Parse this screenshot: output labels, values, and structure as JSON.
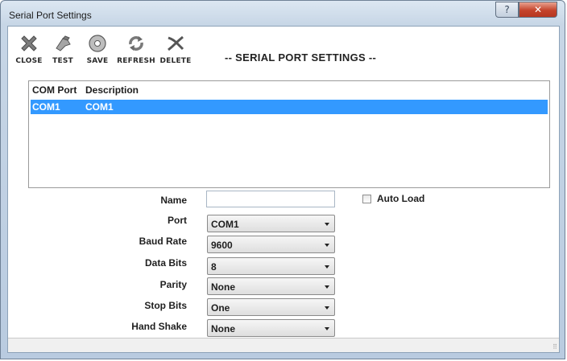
{
  "window": {
    "title": "Serial Port Settings",
    "help_label": "?",
    "close_label": "✕"
  },
  "toolbar": {
    "buttons": [
      {
        "label": "CLOSE",
        "icon": "close-x-icon"
      },
      {
        "label": "TEST",
        "icon": "test-probe-icon"
      },
      {
        "label": "SAVE",
        "icon": "disk-icon"
      },
      {
        "label": "REFRESH",
        "icon": "refresh-icon"
      },
      {
        "label": "DELETE",
        "icon": "delete-icon"
      }
    ],
    "heading": "-- SERIAL PORT SETTINGS --"
  },
  "list": {
    "columns": [
      "COM Port",
      "Description"
    ],
    "rows": [
      {
        "com_port": "COM1",
        "description": "COM1",
        "selected": true
      }
    ]
  },
  "form": {
    "name": {
      "label": "Name",
      "value": ""
    },
    "auto_load": {
      "label": "Auto Load",
      "checked": false
    },
    "port": {
      "label": "Port",
      "value": "COM1"
    },
    "baud_rate": {
      "label": "Baud Rate",
      "value": "9600"
    },
    "data_bits": {
      "label": "Data Bits",
      "value": "8"
    },
    "parity": {
      "label": "Parity",
      "value": "None"
    },
    "stop_bits": {
      "label": "Stop Bits",
      "value": "One"
    },
    "hand_shake": {
      "label": "Hand Shake",
      "value": "None"
    }
  },
  "colors": {
    "selection": "#3399ff",
    "close_button": "#c4432b"
  }
}
